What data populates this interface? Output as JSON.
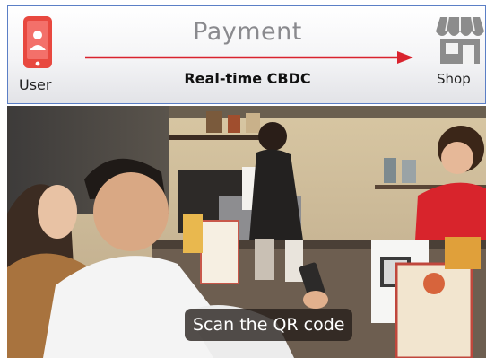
{
  "panel": {
    "title": "Payment",
    "flow_label": "Real-time CBDC",
    "sender": {
      "label": "User",
      "icon": "phone-user-icon"
    },
    "receiver": {
      "label": "Shop",
      "icon": "storefront-icon"
    },
    "arrow_color": "#d9232e",
    "accent_color": "#e8483f"
  },
  "video": {
    "caption": "Scan the QR code"
  }
}
